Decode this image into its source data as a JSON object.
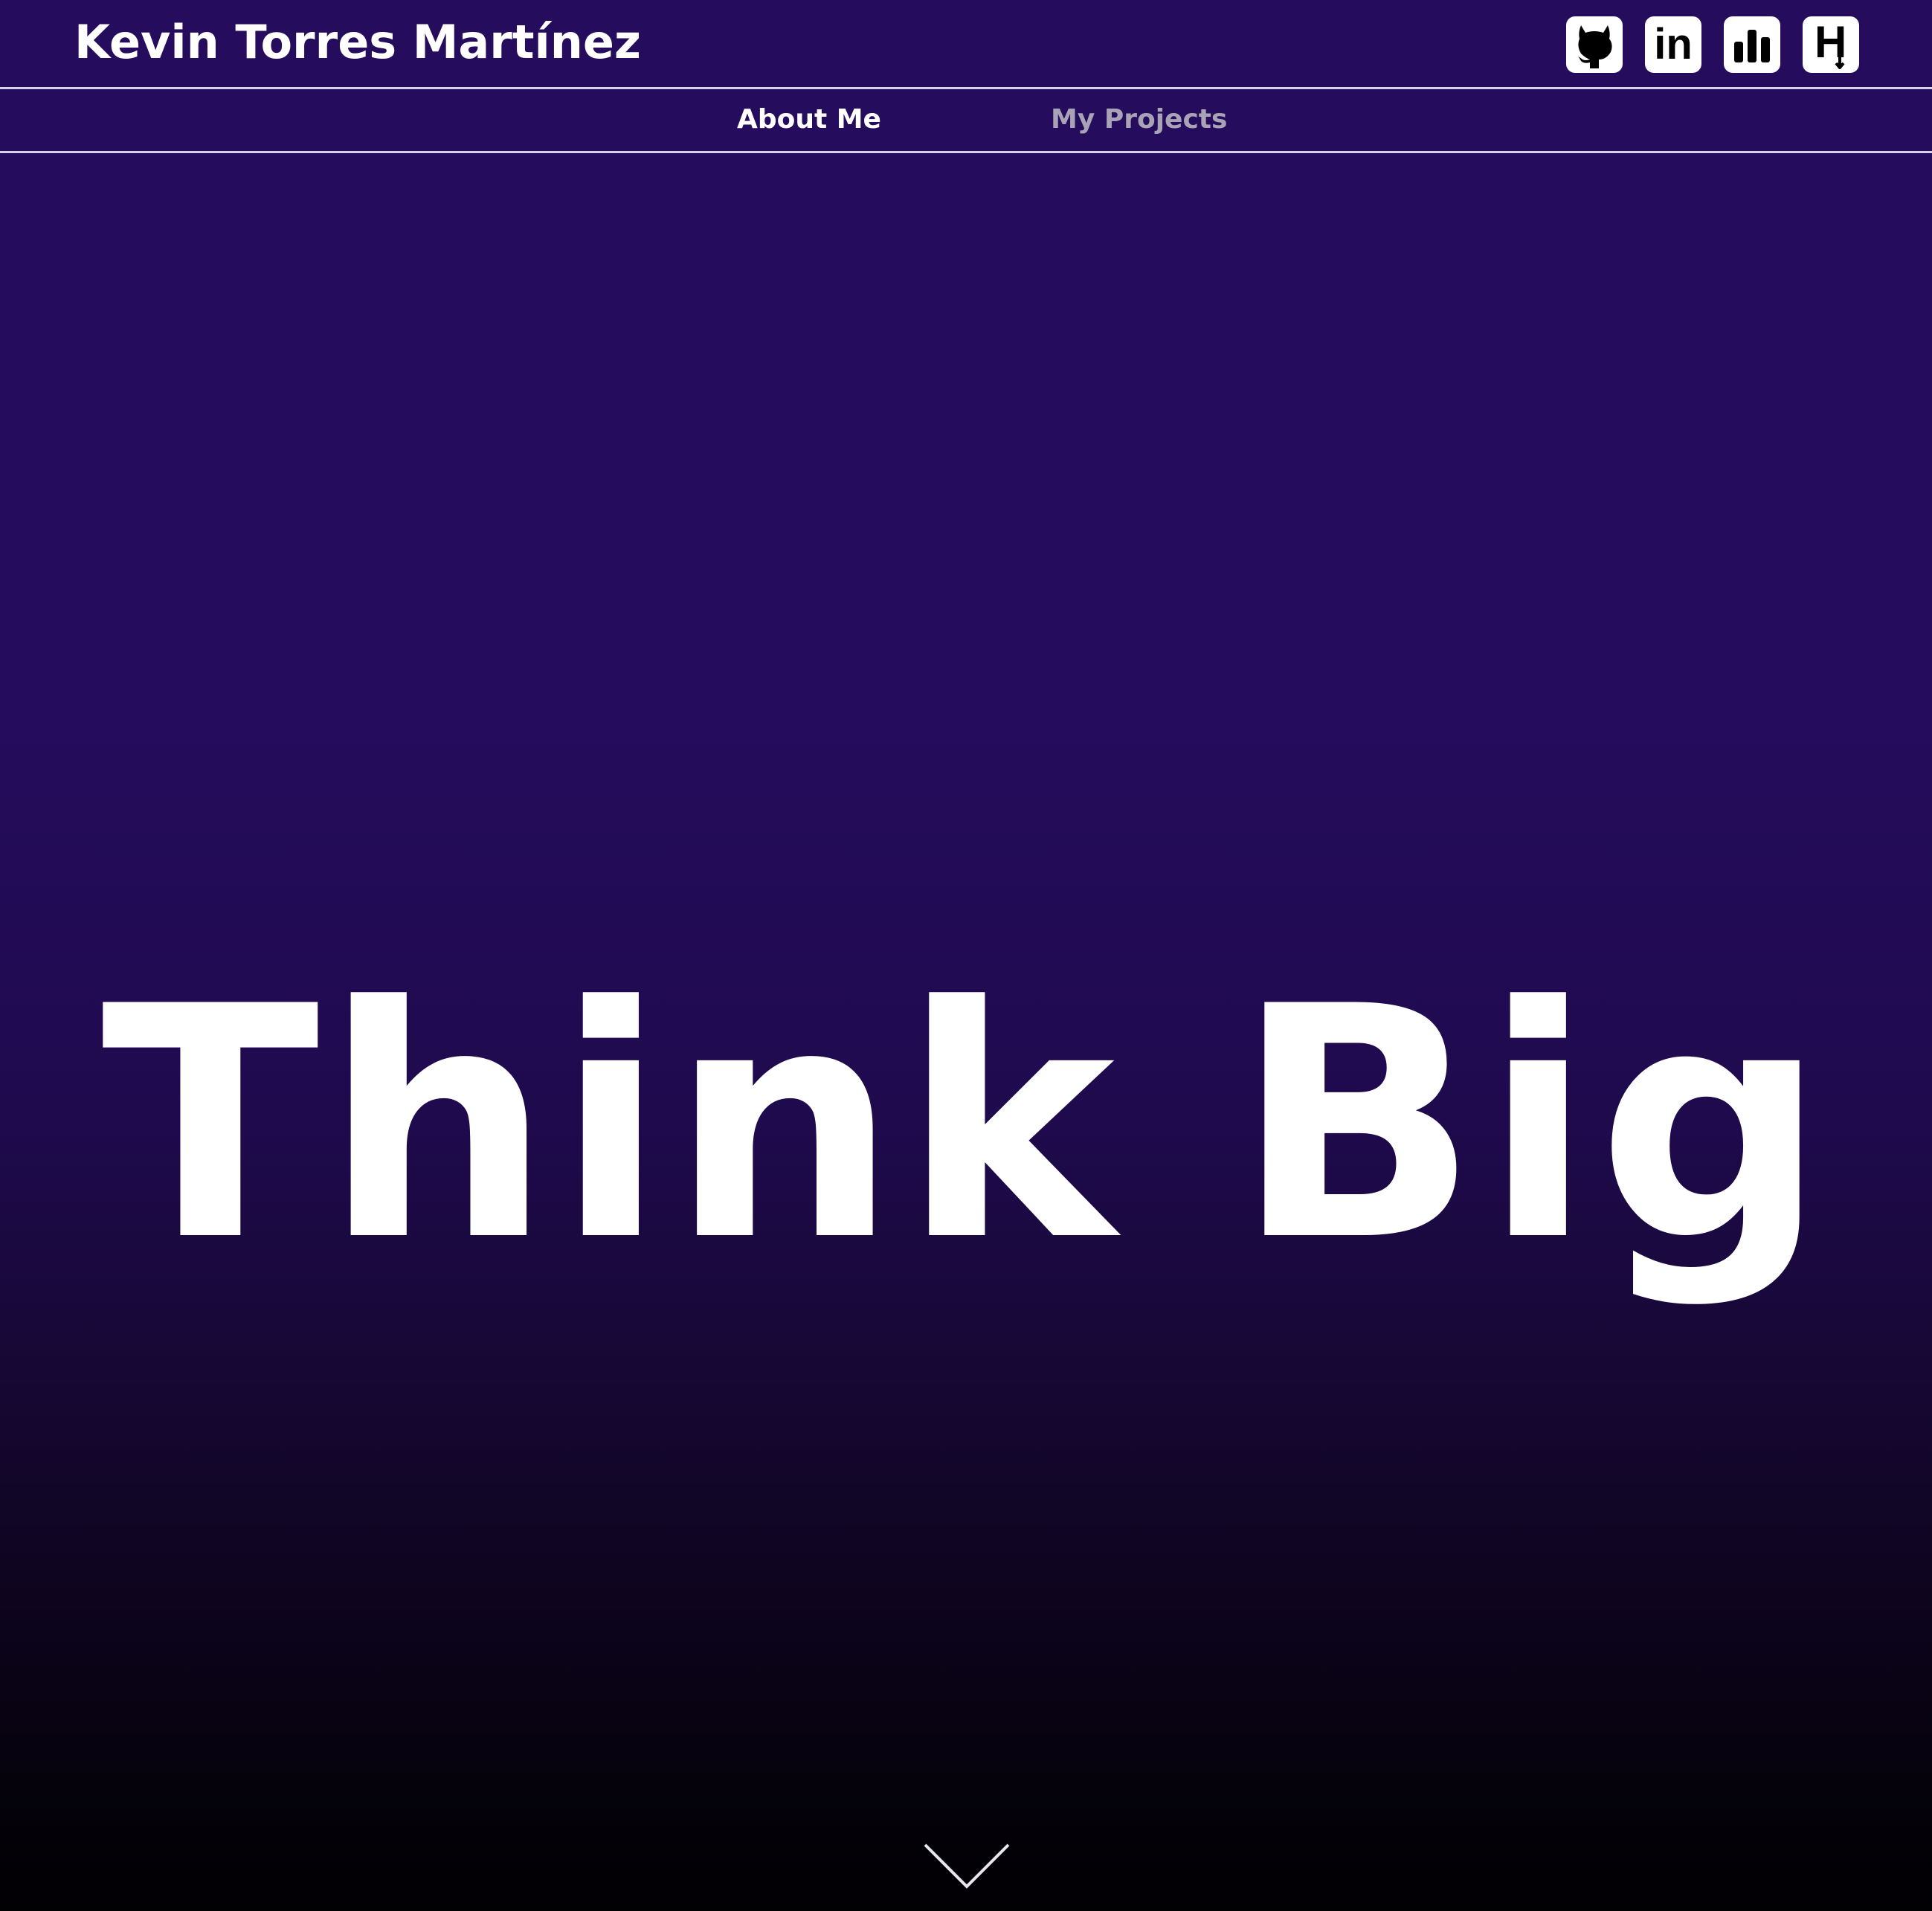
{
  "header": {
    "title": "Kevin Torres Martínez",
    "social_links": [
      {
        "name": "github",
        "icon": "github-icon"
      },
      {
        "name": "linkedin",
        "icon": "linkedin-icon",
        "glyph": "in"
      },
      {
        "name": "stats",
        "icon": "bar-chart-icon"
      },
      {
        "name": "hackerrank",
        "icon": "hackerrank-icon",
        "glyph": "H"
      }
    ]
  },
  "nav": {
    "items": [
      {
        "label": "About Me",
        "active": true
      },
      {
        "label": "My Projects",
        "active": false
      }
    ]
  },
  "hero": {
    "headline": "Think Big",
    "scroll_icon": "chevron-down-icon"
  },
  "colors": {
    "background_top": "#250c5c",
    "background_bottom": "#010003",
    "text": "#ffffff",
    "nav_inactive": "#a9a3b6",
    "divider": "#d8d0ec"
  }
}
